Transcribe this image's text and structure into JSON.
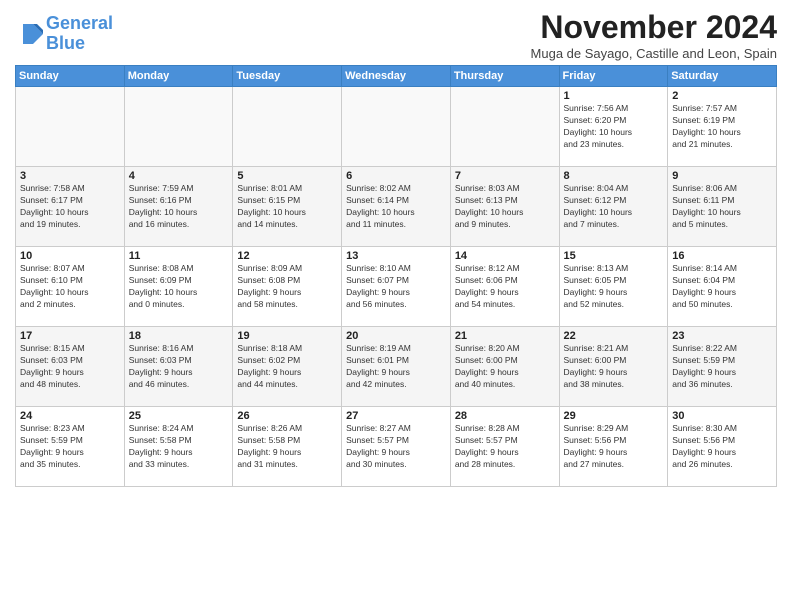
{
  "header": {
    "logo_line1": "General",
    "logo_line2": "Blue",
    "month": "November 2024",
    "location": "Muga de Sayago, Castille and Leon, Spain"
  },
  "days_of_week": [
    "Sunday",
    "Monday",
    "Tuesday",
    "Wednesday",
    "Thursday",
    "Friday",
    "Saturday"
  ],
  "weeks": [
    [
      {
        "day": "",
        "info": ""
      },
      {
        "day": "",
        "info": ""
      },
      {
        "day": "",
        "info": ""
      },
      {
        "day": "",
        "info": ""
      },
      {
        "day": "",
        "info": ""
      },
      {
        "day": "1",
        "info": "Sunrise: 7:56 AM\nSunset: 6:20 PM\nDaylight: 10 hours\nand 23 minutes."
      },
      {
        "day": "2",
        "info": "Sunrise: 7:57 AM\nSunset: 6:19 PM\nDaylight: 10 hours\nand 21 minutes."
      }
    ],
    [
      {
        "day": "3",
        "info": "Sunrise: 7:58 AM\nSunset: 6:17 PM\nDaylight: 10 hours\nand 19 minutes."
      },
      {
        "day": "4",
        "info": "Sunrise: 7:59 AM\nSunset: 6:16 PM\nDaylight: 10 hours\nand 16 minutes."
      },
      {
        "day": "5",
        "info": "Sunrise: 8:01 AM\nSunset: 6:15 PM\nDaylight: 10 hours\nand 14 minutes."
      },
      {
        "day": "6",
        "info": "Sunrise: 8:02 AM\nSunset: 6:14 PM\nDaylight: 10 hours\nand 11 minutes."
      },
      {
        "day": "7",
        "info": "Sunrise: 8:03 AM\nSunset: 6:13 PM\nDaylight: 10 hours\nand 9 minutes."
      },
      {
        "day": "8",
        "info": "Sunrise: 8:04 AM\nSunset: 6:12 PM\nDaylight: 10 hours\nand 7 minutes."
      },
      {
        "day": "9",
        "info": "Sunrise: 8:06 AM\nSunset: 6:11 PM\nDaylight: 10 hours\nand 5 minutes."
      }
    ],
    [
      {
        "day": "10",
        "info": "Sunrise: 8:07 AM\nSunset: 6:10 PM\nDaylight: 10 hours\nand 2 minutes."
      },
      {
        "day": "11",
        "info": "Sunrise: 8:08 AM\nSunset: 6:09 PM\nDaylight: 10 hours\nand 0 minutes."
      },
      {
        "day": "12",
        "info": "Sunrise: 8:09 AM\nSunset: 6:08 PM\nDaylight: 9 hours\nand 58 minutes."
      },
      {
        "day": "13",
        "info": "Sunrise: 8:10 AM\nSunset: 6:07 PM\nDaylight: 9 hours\nand 56 minutes."
      },
      {
        "day": "14",
        "info": "Sunrise: 8:12 AM\nSunset: 6:06 PM\nDaylight: 9 hours\nand 54 minutes."
      },
      {
        "day": "15",
        "info": "Sunrise: 8:13 AM\nSunset: 6:05 PM\nDaylight: 9 hours\nand 52 minutes."
      },
      {
        "day": "16",
        "info": "Sunrise: 8:14 AM\nSunset: 6:04 PM\nDaylight: 9 hours\nand 50 minutes."
      }
    ],
    [
      {
        "day": "17",
        "info": "Sunrise: 8:15 AM\nSunset: 6:03 PM\nDaylight: 9 hours\nand 48 minutes."
      },
      {
        "day": "18",
        "info": "Sunrise: 8:16 AM\nSunset: 6:03 PM\nDaylight: 9 hours\nand 46 minutes."
      },
      {
        "day": "19",
        "info": "Sunrise: 8:18 AM\nSunset: 6:02 PM\nDaylight: 9 hours\nand 44 minutes."
      },
      {
        "day": "20",
        "info": "Sunrise: 8:19 AM\nSunset: 6:01 PM\nDaylight: 9 hours\nand 42 minutes."
      },
      {
        "day": "21",
        "info": "Sunrise: 8:20 AM\nSunset: 6:00 PM\nDaylight: 9 hours\nand 40 minutes."
      },
      {
        "day": "22",
        "info": "Sunrise: 8:21 AM\nSunset: 6:00 PM\nDaylight: 9 hours\nand 38 minutes."
      },
      {
        "day": "23",
        "info": "Sunrise: 8:22 AM\nSunset: 5:59 PM\nDaylight: 9 hours\nand 36 minutes."
      }
    ],
    [
      {
        "day": "24",
        "info": "Sunrise: 8:23 AM\nSunset: 5:59 PM\nDaylight: 9 hours\nand 35 minutes."
      },
      {
        "day": "25",
        "info": "Sunrise: 8:24 AM\nSunset: 5:58 PM\nDaylight: 9 hours\nand 33 minutes."
      },
      {
        "day": "26",
        "info": "Sunrise: 8:26 AM\nSunset: 5:58 PM\nDaylight: 9 hours\nand 31 minutes."
      },
      {
        "day": "27",
        "info": "Sunrise: 8:27 AM\nSunset: 5:57 PM\nDaylight: 9 hours\nand 30 minutes."
      },
      {
        "day": "28",
        "info": "Sunrise: 8:28 AM\nSunset: 5:57 PM\nDaylight: 9 hours\nand 28 minutes."
      },
      {
        "day": "29",
        "info": "Sunrise: 8:29 AM\nSunset: 5:56 PM\nDaylight: 9 hours\nand 27 minutes."
      },
      {
        "day": "30",
        "info": "Sunrise: 8:30 AM\nSunset: 5:56 PM\nDaylight: 9 hours\nand 26 minutes."
      }
    ]
  ]
}
